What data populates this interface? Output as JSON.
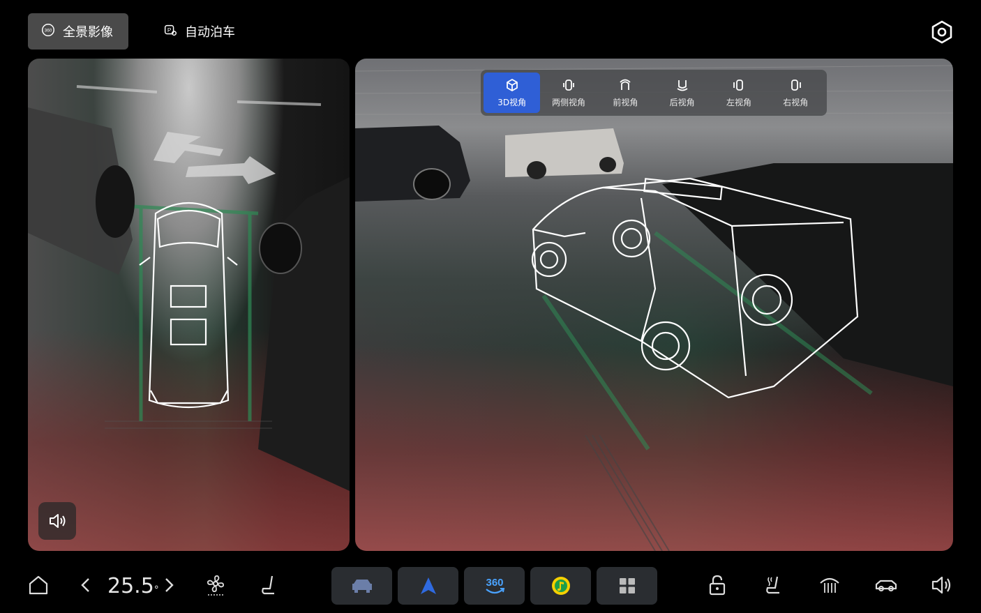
{
  "tabs": [
    {
      "label": "全景影像",
      "active": true
    },
    {
      "label": "自动泊车",
      "active": false
    }
  ],
  "view_modes": [
    {
      "label": "3D视角",
      "selected": true,
      "icon": "cube-icon"
    },
    {
      "label": "两侧视角",
      "selected": false,
      "icon": "car-sides-icon"
    },
    {
      "label": "前视角",
      "selected": false,
      "icon": "car-front-icon"
    },
    {
      "label": "后视角",
      "selected": false,
      "icon": "car-rear-icon"
    },
    {
      "label": "左视角",
      "selected": false,
      "icon": "car-left-icon"
    },
    {
      "label": "右视角",
      "selected": false,
      "icon": "car-right-icon"
    }
  ],
  "dock": {
    "temperature": "25.5",
    "temperature_unit": "°"
  },
  "colors": {
    "accent": "#2f5fd6",
    "tab_active_bg": "#4a4a4a",
    "dock_app_bg": "#2a2d31"
  }
}
